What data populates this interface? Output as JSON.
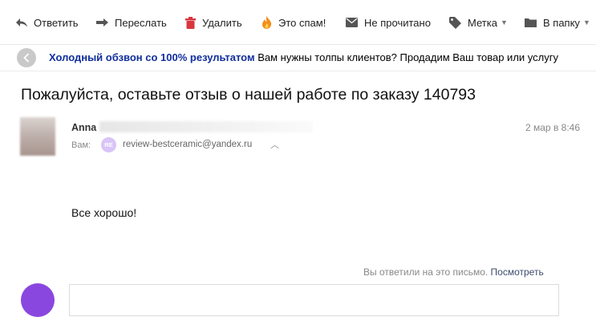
{
  "toolbar": {
    "reply": "Ответить",
    "forward": "Переслать",
    "delete": "Удалить",
    "spam": "Это спам!",
    "unread": "Не прочитано",
    "label": "Метка",
    "folder": "В папку"
  },
  "ad": {
    "title": "Холодный обзвон со 100% результатом",
    "text": "Вам нужны толпы клиентов? Продадим Ваш товар или услугу"
  },
  "message": {
    "subject": "Пожалуйста, оставьте отзыв о нашей работе по заказу 140793",
    "sender_name": "Anna",
    "date": "2 мар в 8:46",
    "to_label": "Вам:",
    "to_badge": "RE",
    "to_email": "review-bestceramic@yandex.ru",
    "body": "Все хорошо!",
    "replied_notice": "Вы ответили на это письмо.",
    "replied_link": "Посмотреть"
  },
  "colors": {
    "ad_title": "#112e9c",
    "avatar_bottom": "#8a47df",
    "re_badge": "#d9c4f7"
  }
}
